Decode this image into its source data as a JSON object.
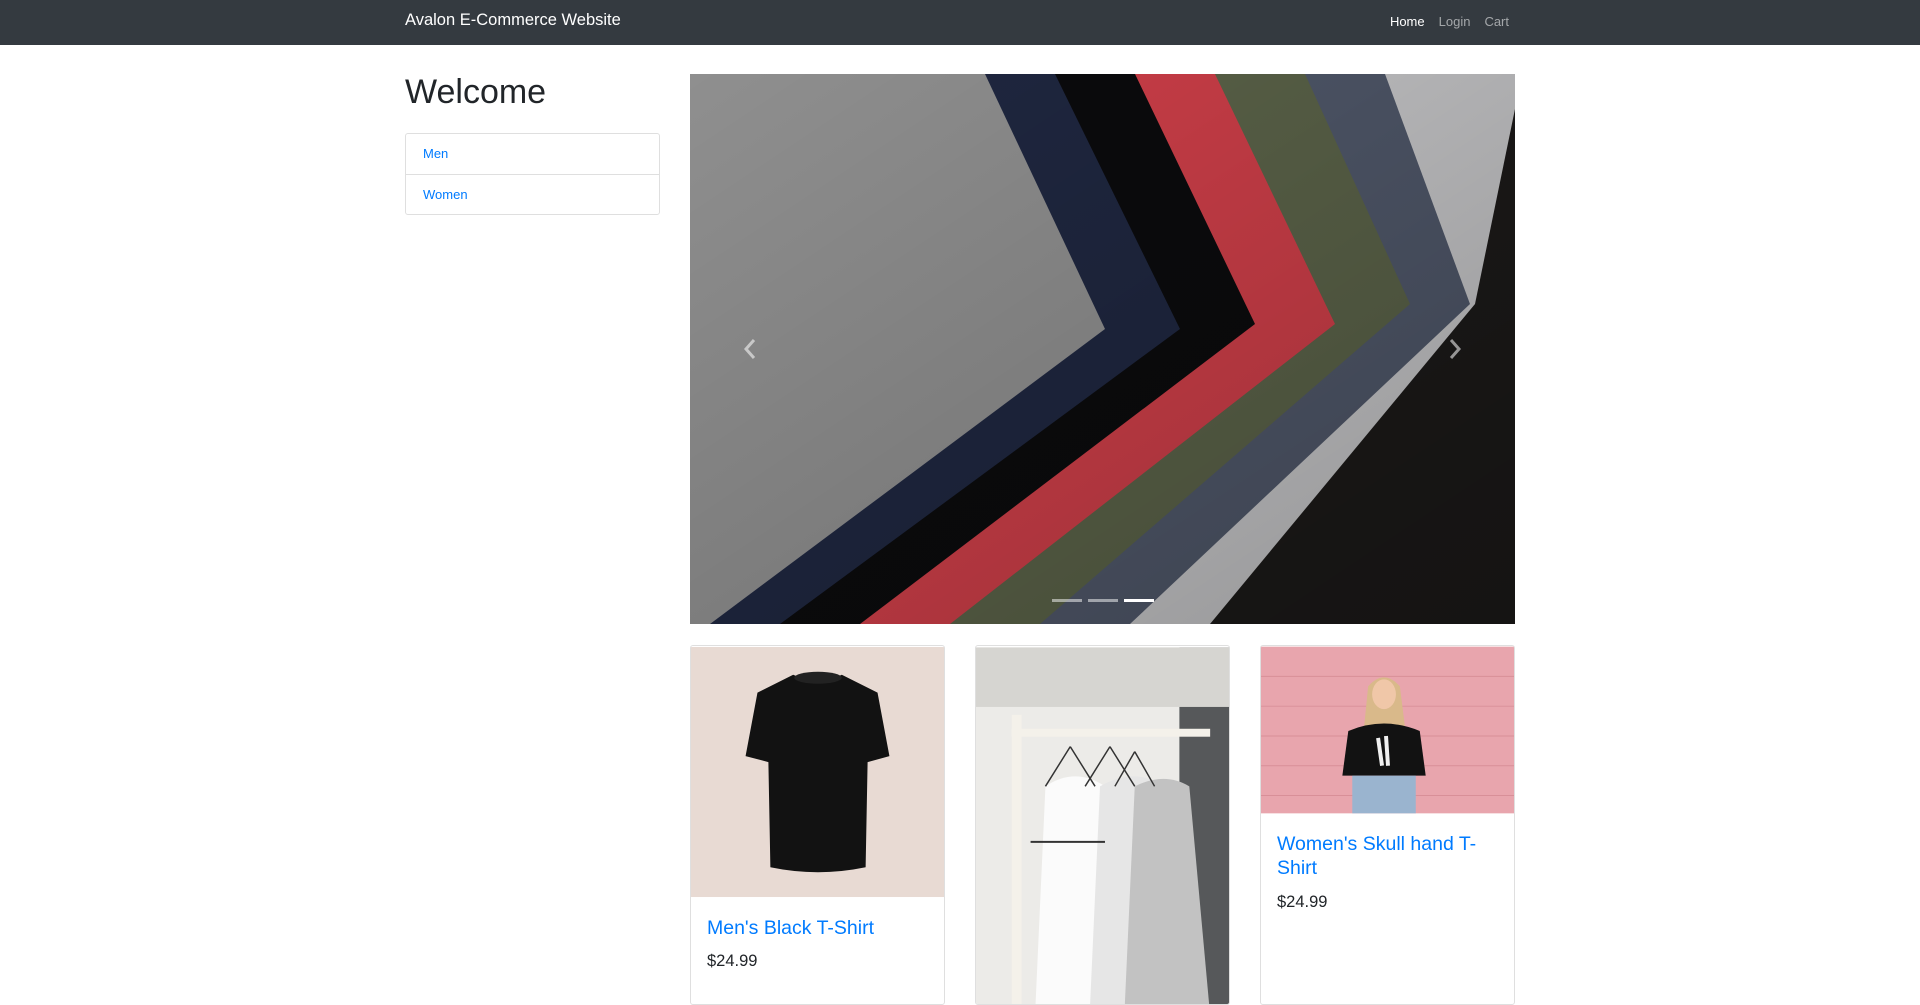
{
  "navbar": {
    "brand": "Avalon E-Commerce Website",
    "links": [
      {
        "label": "Home",
        "active": true
      },
      {
        "label": "Login",
        "active": false
      },
      {
        "label": "Cart",
        "active": false
      }
    ]
  },
  "sidebar": {
    "heading": "Welcome",
    "categories": [
      {
        "label": "Men"
      },
      {
        "label": "Women"
      }
    ]
  },
  "carousel": {
    "slide_count": 3,
    "active_index": 2,
    "prev_icon": "chevron-left-icon",
    "next_icon": "chevron-right-icon"
  },
  "products": [
    {
      "title": "Men's Black T-Shirt",
      "price": "$24.99"
    },
    {
      "title": "",
      "price": ""
    },
    {
      "title": "Women's Skull hand T-Shirt",
      "price": "$24.99"
    }
  ],
  "colors": {
    "navbar_bg": "#343a40",
    "link": "#007bff",
    "text": "#212529"
  }
}
